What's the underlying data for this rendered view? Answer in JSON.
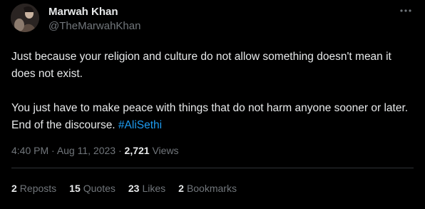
{
  "author": {
    "name": "Marwah Khan",
    "handle": "@TheMarwahKhan"
  },
  "more_icon": "more-horizontal-icon",
  "tweet": {
    "paragraph1": "Just because your religion and culture do not allow something doesn't mean it does not exist.",
    "paragraph2_text": "You just have to make peace with things that do not harm anyone sooner or later. End of the discourse. ",
    "hashtag": "#AliSethi"
  },
  "meta": {
    "time": "4:40 PM",
    "sep1": " · ",
    "date": "Aug 11, 2023",
    "sep2": " · ",
    "views_count": "2,721",
    "views_label": "Views"
  },
  "stats": {
    "reposts_count": "2",
    "reposts_label": "Reposts",
    "quotes_count": "15",
    "quotes_label": "Quotes",
    "likes_count": "23",
    "likes_label": "Likes",
    "bookmarks_count": "2",
    "bookmarks_label": "Bookmarks"
  },
  "colors": {
    "background": "#000000",
    "text": "#e7e9ea",
    "secondary": "#71767b",
    "link": "#1d9bf0",
    "divider": "#2f3336"
  }
}
